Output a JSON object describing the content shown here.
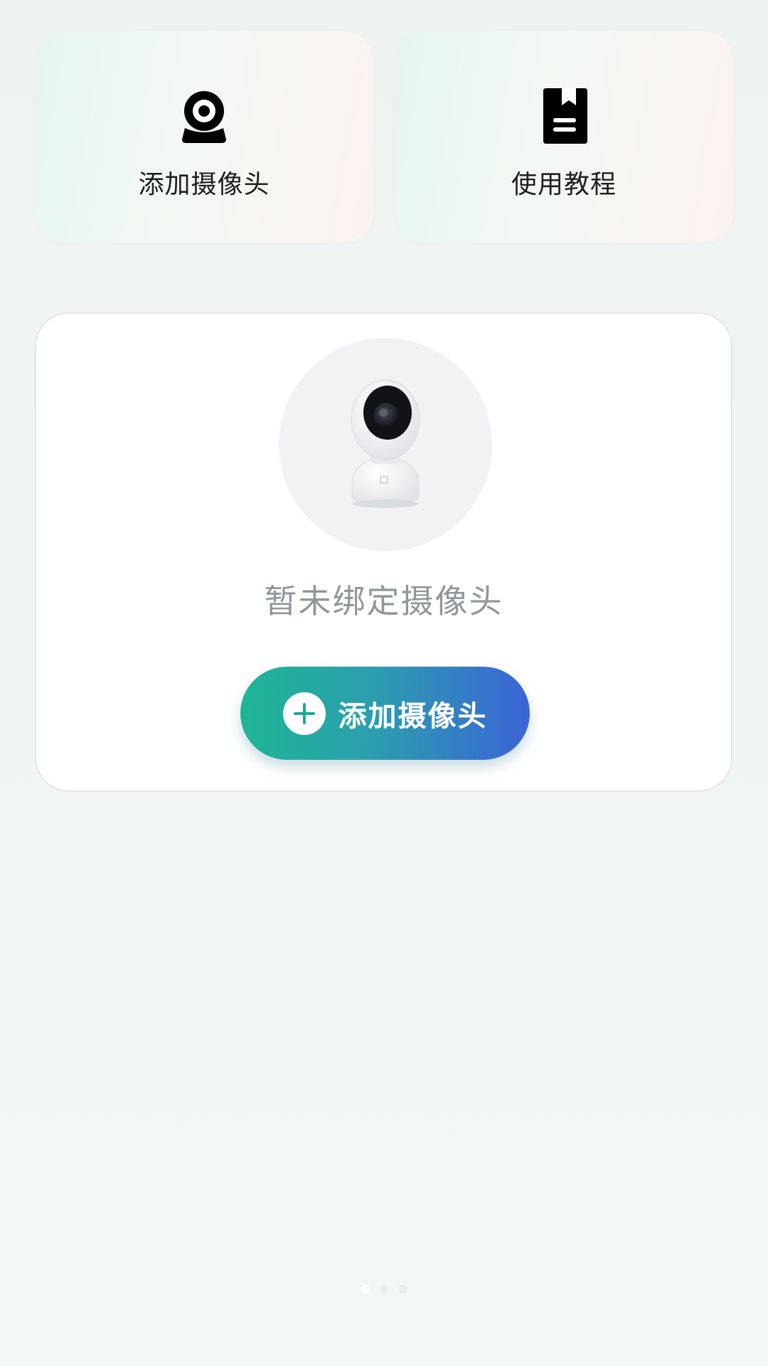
{
  "quick_actions": [
    {
      "label": "添加摄像头",
      "icon": "webcam-icon"
    },
    {
      "label": "使用教程",
      "icon": "guide-book-icon"
    }
  ],
  "main_card": {
    "empty_text": "暂未绑定摄像头",
    "add_button_label": "添加摄像头",
    "add_button_icon": "plus-circle-icon",
    "device_image": "security-camera-image"
  },
  "colors": {
    "button_gradient_start": "#1fb596",
    "button_gradient_end": "#3b64d6",
    "empty_text": "#8f979c",
    "plus_icon": "#1fa89a"
  }
}
